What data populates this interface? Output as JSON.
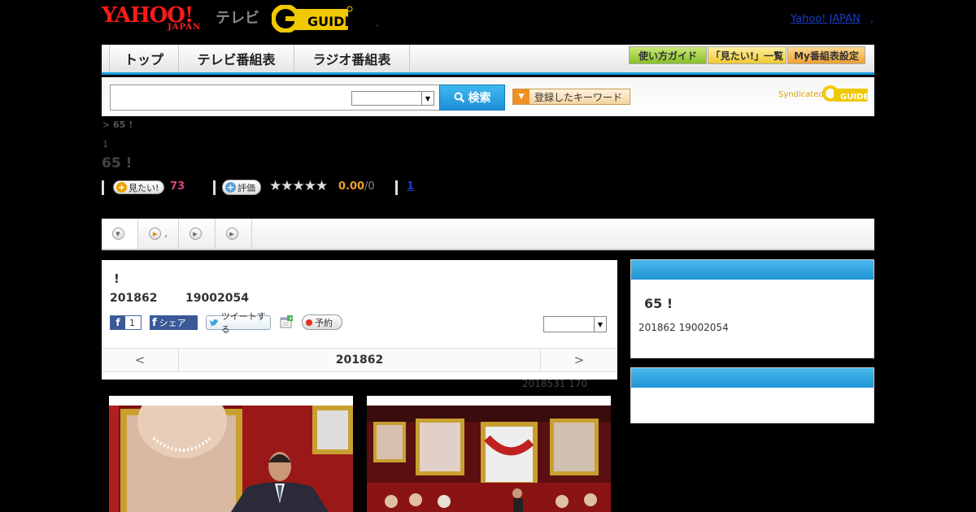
{
  "header": {
    "logo_yahoo": "YAHOO!",
    "logo_japan": "JAPAN",
    "logo_tv": "テレビ",
    "logo_gguide": "G-GUIDE",
    "dot": ",",
    "yahoo_japan_link": "Yahoo! JAPAN",
    "link_sep": ","
  },
  "nav": {
    "tabs": [
      "トップ",
      "テレビ番組表",
      "ラジオ番組表"
    ],
    "buttons": [
      "使い方ガイド",
      "「見たい!」一覧",
      "My番組表設定"
    ]
  },
  "search": {
    "input_value": "",
    "select_value": "",
    "button_label": "検索",
    "keyword_button": "登録したキーワード",
    "syndicated": "Syndicated",
    "syndicated_logo": "G-GUIDE"
  },
  "program": {
    "breadcrumb": "> 65 !",
    "number": "1",
    "title": "65 !",
    "want_label": "見たい!",
    "want_count": "73",
    "rate_label": "評価",
    "stars": "★★★★★",
    "score": "0.00",
    "score_max": "/0",
    "review_link": "1"
  },
  "tabs": [
    {
      "icon": "down-circle-icon",
      "label": ""
    },
    {
      "icon": "play-circle-icon",
      "label": ","
    },
    {
      "icon": "play-circle-icon",
      "label": ""
    },
    {
      "icon": "play-circle-icon",
      "label": ""
    }
  ],
  "main": {
    "title": "!",
    "date": "201862",
    "time": "19002054",
    "fb_like_count": "1",
    "fb_share": "シェア",
    "tweet": "ツイートする",
    "reserve": "予約",
    "select_value": "",
    "pager_prev": "<",
    "pager_current": "201862",
    "pager_next": ">",
    "updated": "2018531  170"
  },
  "side": {
    "title": "65 !",
    "info": "201862  19002054"
  },
  "colors": {
    "accent_blue": "#1aa0e0",
    "yahoo_red": "#ff1a1a",
    "gguide_yellow": "#f0c800",
    "want_pink": "#e0408a",
    "score_orange": "#f0a030"
  }
}
